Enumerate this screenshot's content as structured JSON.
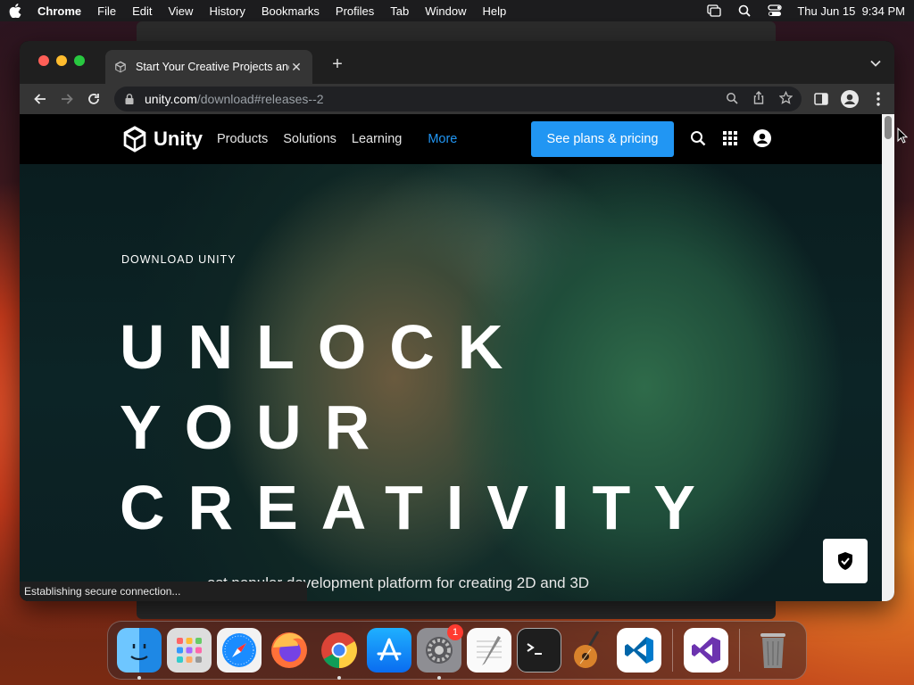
{
  "menubar": {
    "apple_icon": "apple-icon",
    "items": [
      "Chrome",
      "File",
      "Edit",
      "View",
      "History",
      "Bookmarks",
      "Profiles",
      "Tab",
      "Window",
      "Help"
    ],
    "status_icons": [
      "screen-mirroring-icon",
      "spotlight-icon",
      "control-center-icon"
    ],
    "clock": "Thu Jun 15  9:34 PM"
  },
  "browser": {
    "tab_title": "Start Your Creative Projects and",
    "url_domain": "unity.com",
    "url_path": "/download#releases--2",
    "status_text": "Establishing secure connection..."
  },
  "site": {
    "logo_text": "Unity",
    "nav": [
      "Products",
      "Solutions",
      "Learning"
    ],
    "nav_more": "More",
    "cta": "See plans & pricing",
    "eyebrow": "DOWNLOAD UNITY",
    "headline_1": "UNLOCK",
    "headline_2": "YOUR",
    "headline_3": "CREATIVITY",
    "subline": "ost popular development platform for creating 2D and 3D"
  },
  "dock": {
    "apps": [
      "Finder",
      "Launchpad",
      "Safari",
      "Firefox",
      "Chrome",
      "App Store",
      "System Preferences",
      "TextEdit",
      "Terminal",
      "GarageBand",
      "Visual Studio Code",
      "Visual Studio",
      "Trash"
    ],
    "badge_system_prefs": "1"
  },
  "colors": {
    "accent": "#2196f3",
    "menubar": "#1c1c1e",
    "tab_active": "#353535"
  }
}
